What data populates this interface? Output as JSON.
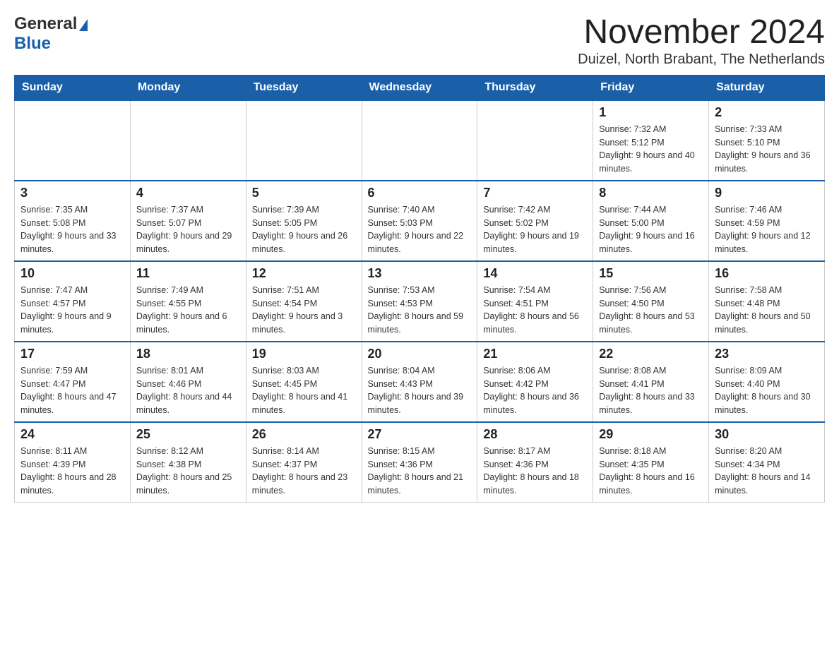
{
  "logo": {
    "general": "General",
    "triangle": "▶",
    "blue": "Blue"
  },
  "header": {
    "title": "November 2024",
    "subtitle": "Duizel, North Brabant, The Netherlands"
  },
  "weekdays": [
    "Sunday",
    "Monday",
    "Tuesday",
    "Wednesday",
    "Thursday",
    "Friday",
    "Saturday"
  ],
  "weeks": [
    [
      {
        "day": "",
        "info": ""
      },
      {
        "day": "",
        "info": ""
      },
      {
        "day": "",
        "info": ""
      },
      {
        "day": "",
        "info": ""
      },
      {
        "day": "",
        "info": ""
      },
      {
        "day": "1",
        "info": "Sunrise: 7:32 AM\nSunset: 5:12 PM\nDaylight: 9 hours and 40 minutes."
      },
      {
        "day": "2",
        "info": "Sunrise: 7:33 AM\nSunset: 5:10 PM\nDaylight: 9 hours and 36 minutes."
      }
    ],
    [
      {
        "day": "3",
        "info": "Sunrise: 7:35 AM\nSunset: 5:08 PM\nDaylight: 9 hours and 33 minutes."
      },
      {
        "day": "4",
        "info": "Sunrise: 7:37 AM\nSunset: 5:07 PM\nDaylight: 9 hours and 29 minutes."
      },
      {
        "day": "5",
        "info": "Sunrise: 7:39 AM\nSunset: 5:05 PM\nDaylight: 9 hours and 26 minutes."
      },
      {
        "day": "6",
        "info": "Sunrise: 7:40 AM\nSunset: 5:03 PM\nDaylight: 9 hours and 22 minutes."
      },
      {
        "day": "7",
        "info": "Sunrise: 7:42 AM\nSunset: 5:02 PM\nDaylight: 9 hours and 19 minutes."
      },
      {
        "day": "8",
        "info": "Sunrise: 7:44 AM\nSunset: 5:00 PM\nDaylight: 9 hours and 16 minutes."
      },
      {
        "day": "9",
        "info": "Sunrise: 7:46 AM\nSunset: 4:59 PM\nDaylight: 9 hours and 12 minutes."
      }
    ],
    [
      {
        "day": "10",
        "info": "Sunrise: 7:47 AM\nSunset: 4:57 PM\nDaylight: 9 hours and 9 minutes."
      },
      {
        "day": "11",
        "info": "Sunrise: 7:49 AM\nSunset: 4:55 PM\nDaylight: 9 hours and 6 minutes."
      },
      {
        "day": "12",
        "info": "Sunrise: 7:51 AM\nSunset: 4:54 PM\nDaylight: 9 hours and 3 minutes."
      },
      {
        "day": "13",
        "info": "Sunrise: 7:53 AM\nSunset: 4:53 PM\nDaylight: 8 hours and 59 minutes."
      },
      {
        "day": "14",
        "info": "Sunrise: 7:54 AM\nSunset: 4:51 PM\nDaylight: 8 hours and 56 minutes."
      },
      {
        "day": "15",
        "info": "Sunrise: 7:56 AM\nSunset: 4:50 PM\nDaylight: 8 hours and 53 minutes."
      },
      {
        "day": "16",
        "info": "Sunrise: 7:58 AM\nSunset: 4:48 PM\nDaylight: 8 hours and 50 minutes."
      }
    ],
    [
      {
        "day": "17",
        "info": "Sunrise: 7:59 AM\nSunset: 4:47 PM\nDaylight: 8 hours and 47 minutes."
      },
      {
        "day": "18",
        "info": "Sunrise: 8:01 AM\nSunset: 4:46 PM\nDaylight: 8 hours and 44 minutes."
      },
      {
        "day": "19",
        "info": "Sunrise: 8:03 AM\nSunset: 4:45 PM\nDaylight: 8 hours and 41 minutes."
      },
      {
        "day": "20",
        "info": "Sunrise: 8:04 AM\nSunset: 4:43 PM\nDaylight: 8 hours and 39 minutes."
      },
      {
        "day": "21",
        "info": "Sunrise: 8:06 AM\nSunset: 4:42 PM\nDaylight: 8 hours and 36 minutes."
      },
      {
        "day": "22",
        "info": "Sunrise: 8:08 AM\nSunset: 4:41 PM\nDaylight: 8 hours and 33 minutes."
      },
      {
        "day": "23",
        "info": "Sunrise: 8:09 AM\nSunset: 4:40 PM\nDaylight: 8 hours and 30 minutes."
      }
    ],
    [
      {
        "day": "24",
        "info": "Sunrise: 8:11 AM\nSunset: 4:39 PM\nDaylight: 8 hours and 28 minutes."
      },
      {
        "day": "25",
        "info": "Sunrise: 8:12 AM\nSunset: 4:38 PM\nDaylight: 8 hours and 25 minutes."
      },
      {
        "day": "26",
        "info": "Sunrise: 8:14 AM\nSunset: 4:37 PM\nDaylight: 8 hours and 23 minutes."
      },
      {
        "day": "27",
        "info": "Sunrise: 8:15 AM\nSunset: 4:36 PM\nDaylight: 8 hours and 21 minutes."
      },
      {
        "day": "28",
        "info": "Sunrise: 8:17 AM\nSunset: 4:36 PM\nDaylight: 8 hours and 18 minutes."
      },
      {
        "day": "29",
        "info": "Sunrise: 8:18 AM\nSunset: 4:35 PM\nDaylight: 8 hours and 16 minutes."
      },
      {
        "day": "30",
        "info": "Sunrise: 8:20 AM\nSunset: 4:34 PM\nDaylight: 8 hours and 14 minutes."
      }
    ]
  ]
}
